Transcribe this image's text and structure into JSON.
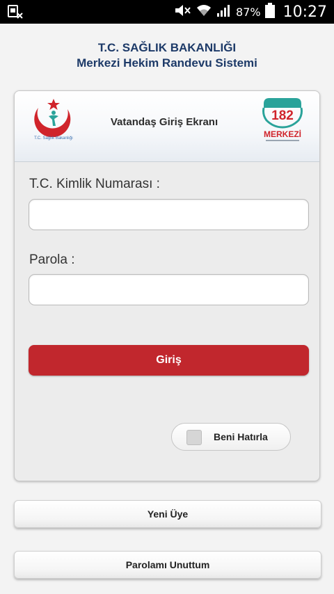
{
  "status_bar": {
    "battery_percent": "87%",
    "time": "10:27",
    "icons": [
      "sim-notification-icon",
      "mute-icon",
      "wifi-icon",
      "signal-icon",
      "battery-icon"
    ]
  },
  "header": {
    "line1": "T.C. SAĞLIK BAKANLIĞI",
    "line2": "Merkezi Hekim Randevu Sistemi"
  },
  "card": {
    "title": "Vatandaş Giriş Ekranı",
    "left_logo_caption": "T.C. Sağlık Bakanlığı",
    "right_logo": {
      "number": "182",
      "word": "MERKEZİ"
    }
  },
  "form": {
    "tc_label": "T.C. Kimlik Numarası :",
    "tc_value": "",
    "password_label": "Parola :",
    "password_value": "",
    "login_button": "Giriş",
    "remember_label": "Beni Hatırla",
    "remember_checked": false
  },
  "actions": {
    "new_member": "Yeni Üye",
    "forgot_password": "Parolamı Unuttum"
  },
  "colors": {
    "primary_red": "#c1272d",
    "header_blue": "#1d3a68",
    "teal": "#2aa39a"
  }
}
